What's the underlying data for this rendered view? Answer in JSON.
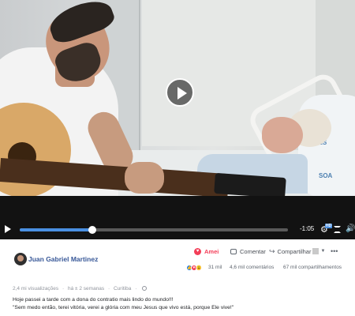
{
  "video": {
    "progress": 0.27,
    "time_remaining": "-1:05",
    "hd_label": "HD",
    "pillow_text_1": "ADES",
    "pillow_text_2": "SOA"
  },
  "post": {
    "author": "Juan Gabriel Martinez",
    "actions": {
      "react_label": "Amei",
      "comment_label": "Comentar",
      "share_label": "Compartilhar"
    },
    "stats": {
      "reactions": "31 mil",
      "comments": "4,6 mil comentários",
      "shares": "67 mil compartilhamentos"
    },
    "meta": {
      "views": "2,4 mi visualizações",
      "time": "há ± 2 semanas",
      "location": "Curitiba"
    },
    "caption_line_1": "Hoje passei a tarde com a dona do contratio mais lindo do mundo!!!",
    "caption_line_2": "\"Sem medo então, terei vitória, verei a glória com meu Jesus que vivo está, porque Ele vive!\""
  },
  "colors": {
    "link_blue": "#385898",
    "love_red": "#f33e58",
    "progress_blue": "#4a90e2"
  },
  "icons": [
    "play-icon",
    "heart-icon",
    "comment-icon",
    "share-icon",
    "more-icon",
    "globe-icon",
    "settings-icon",
    "fullscreen-icon",
    "volume-icon"
  ]
}
